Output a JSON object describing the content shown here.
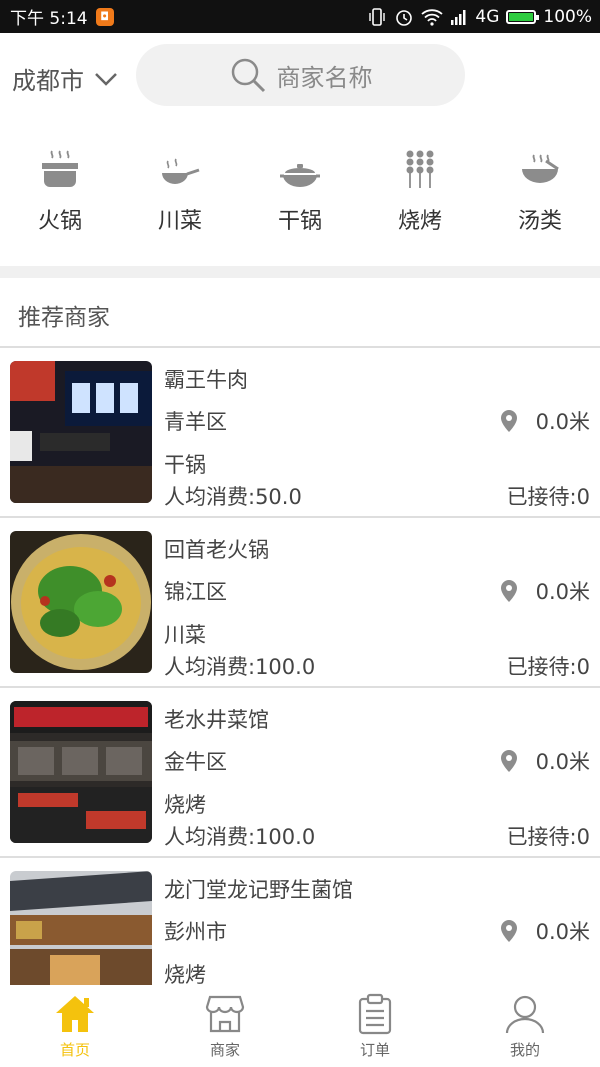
{
  "status_bar": {
    "time": "下午 5:14",
    "network": "4G",
    "battery": "100%",
    "battery_level": 1.0
  },
  "header": {
    "city": "成都市",
    "search_placeholder": "商家名称"
  },
  "categories": [
    {
      "label": "火锅",
      "icon": "hotpot-icon"
    },
    {
      "label": "川菜",
      "icon": "wok-icon"
    },
    {
      "label": "干锅",
      "icon": "dry-pot-icon"
    },
    {
      "label": "烧烤",
      "icon": "skewer-icon"
    },
    {
      "label": "汤类",
      "icon": "soup-bowl-icon"
    }
  ],
  "section_title": "推荐商家",
  "merchants": [
    {
      "name": "霸王牛肉",
      "area": "青羊区",
      "distance": "0.0米",
      "type": "干锅",
      "price": "人均消费:50.0",
      "served": "已接待:0"
    },
    {
      "name": "回首老火锅",
      "area": "锦江区",
      "distance": "0.0米",
      "type": "川菜",
      "price": "人均消费:100.0",
      "served": "已接待:0"
    },
    {
      "name": "老水井菜馆",
      "area": "金牛区",
      "distance": "0.0米",
      "type": "烧烤",
      "price": "人均消费:100.0",
      "served": "已接待:0"
    },
    {
      "name": "龙门堂龙记野生菌馆",
      "area": "彭州市",
      "distance": "0.0米",
      "type": "烧烤",
      "price": "",
      "served": ""
    }
  ],
  "tabs": [
    {
      "label": "首页",
      "icon": "home-icon",
      "active": true
    },
    {
      "label": "商家",
      "icon": "shop-icon",
      "active": false
    },
    {
      "label": "订单",
      "icon": "order-clipboard-icon",
      "active": false
    },
    {
      "label": "我的",
      "icon": "user-icon",
      "active": false
    }
  ],
  "colors": {
    "accent": "#f4c20d",
    "icon_gray": "#8c8c8c",
    "notification": "#f07a1a"
  }
}
